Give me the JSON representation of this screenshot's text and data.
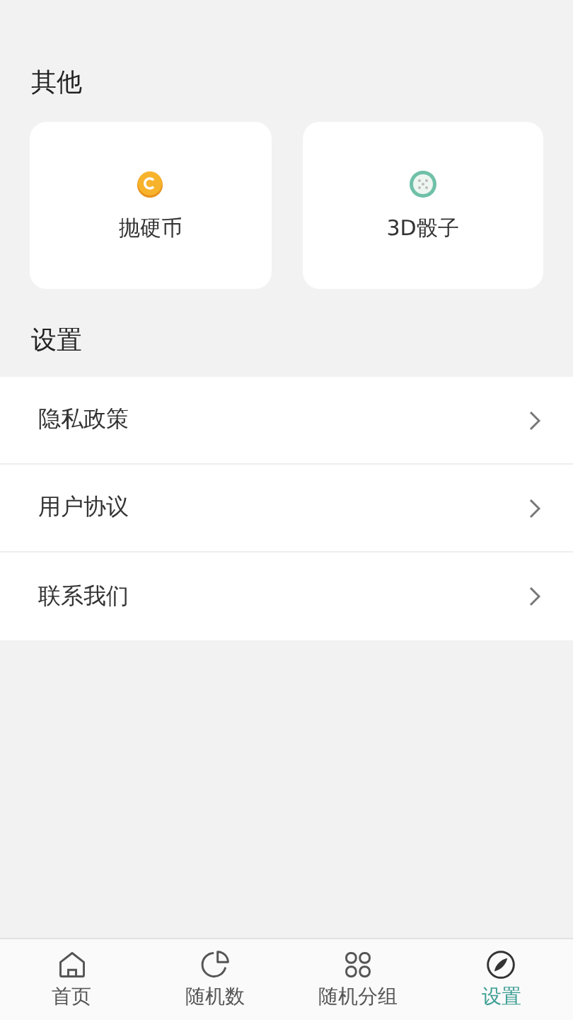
{
  "sections": [
    {
      "title": "其他"
    },
    {
      "title": "设置"
    }
  ],
  "tools": [
    {
      "label": "抛硬币",
      "kind": "coin"
    },
    {
      "label": "3D骰子",
      "kind": "dice"
    }
  ],
  "settings": [
    {
      "label": "隐私政策"
    },
    {
      "label": "用户协议"
    },
    {
      "label": "联系我们"
    }
  ],
  "tabs": [
    {
      "label": "首页",
      "kind": "home",
      "selected": false
    },
    {
      "label": "随机数",
      "kind": "pie",
      "selected": false
    },
    {
      "label": "随机分组",
      "kind": "grid",
      "selected": false
    },
    {
      "label": "设置",
      "kind": "compass",
      "selected": true
    }
  ]
}
